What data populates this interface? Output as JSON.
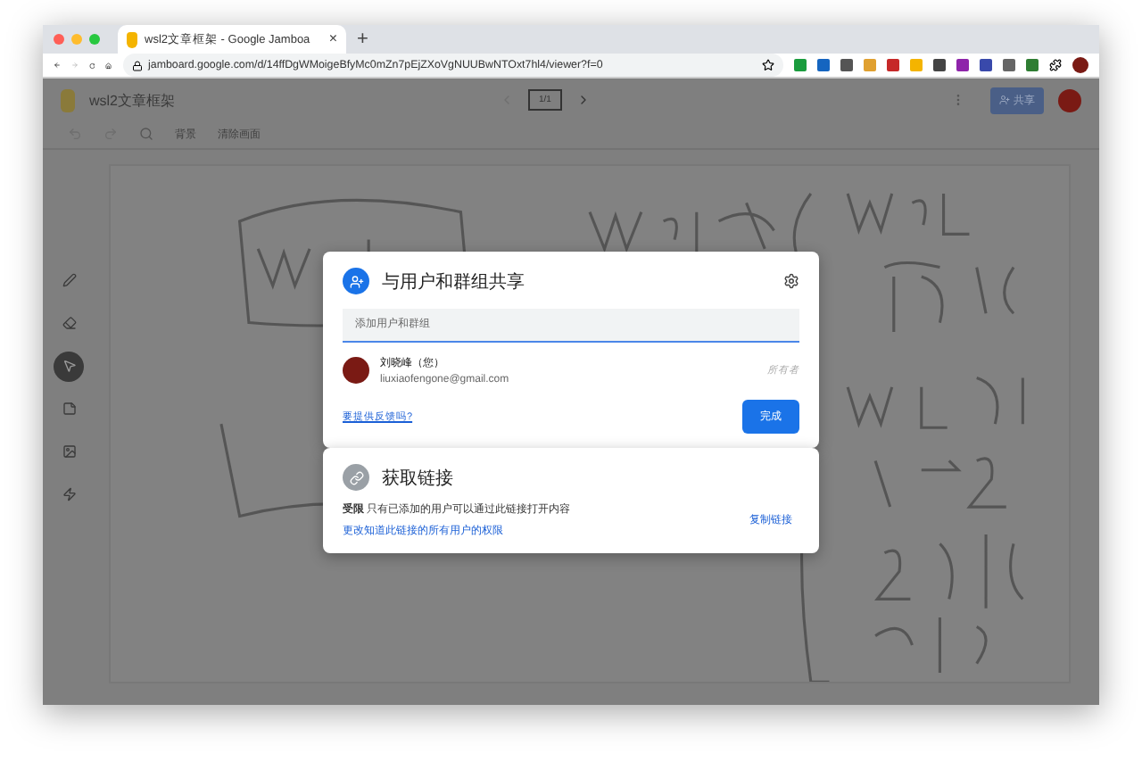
{
  "browser": {
    "tab": {
      "title": "wsl2文章框架 - Google Jamboa",
      "close": "×"
    },
    "new_tab": "+",
    "url": "jamboard.google.com/d/14ffDgWMoigeBfyMc0mZn7pEjZXoVgNUUBwNTOxt7hl4/viewer?f=0"
  },
  "app": {
    "title": "wsl2文章框架",
    "page": "1/1",
    "share_button": "共享",
    "toolbar": [
      "背景",
      "清除画面"
    ],
    "tools": [
      {
        "kind": "pen",
        "selected": false
      },
      {
        "kind": "eraser",
        "selected": false
      },
      {
        "kind": "select",
        "selected": true
      },
      {
        "kind": "note",
        "selected": false
      },
      {
        "kind": "image",
        "selected": false
      },
      {
        "kind": "laser",
        "selected": false
      }
    ]
  },
  "share_dialog": {
    "title": "与用户和群组共享",
    "input": {
      "placeholder": "添加用户和群组"
    },
    "people": [
      {
        "name": "刘晓峰（您）",
        "email": "liuxiaofengone@gmail.com",
        "role": "所有者"
      }
    ],
    "feedback_link": "要提供反馈吗?",
    "done_button": "完成"
  },
  "link_dialog": {
    "title": "获取链接",
    "access_text": "**受限** 只有已添加的用户可以通过此链接打开内容",
    "change_link": "更改知道此链接的所有用户的权限",
    "copy_button": "复制链接"
  }
}
